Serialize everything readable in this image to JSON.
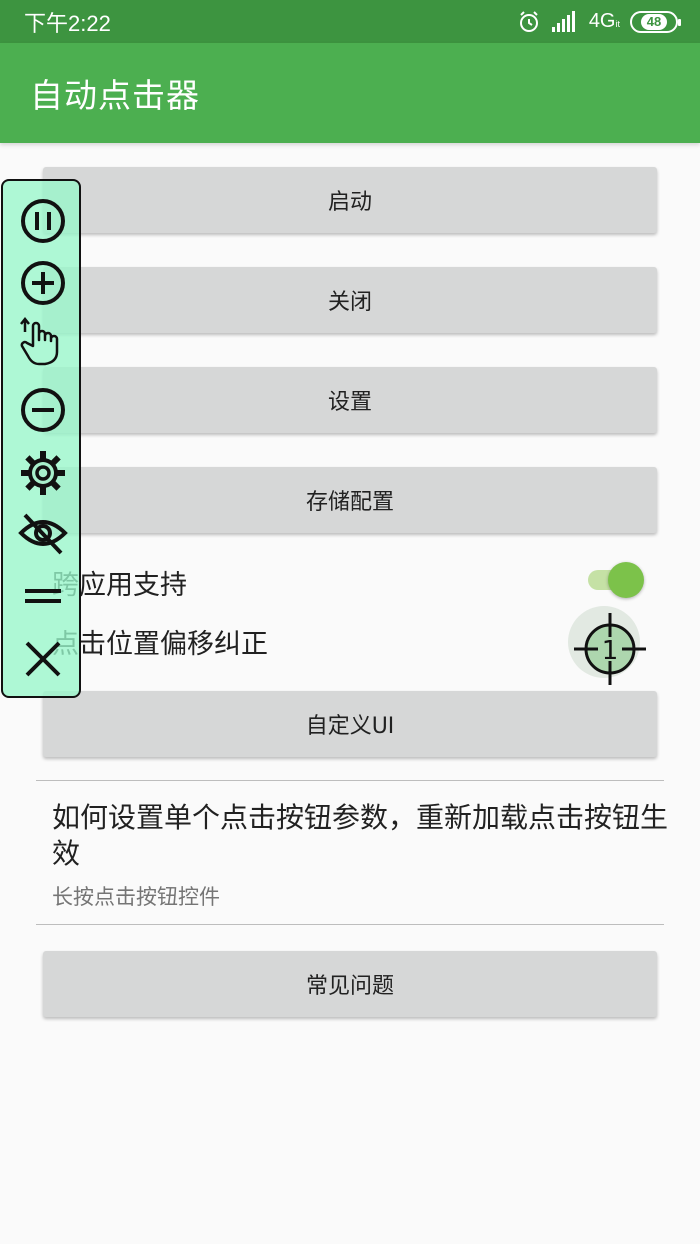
{
  "status_bar": {
    "time": "下午2:22",
    "network": "4G",
    "network_sub": "it",
    "battery": "48",
    "icons": [
      "alarm-icon",
      "signal-icon"
    ]
  },
  "app_bar": {
    "title": "自动点击器"
  },
  "buttons": {
    "start": "启动",
    "close": "关闭",
    "settings": "设置",
    "save_config": "存储配置",
    "custom_ui": "自定义UI",
    "faq": "常见问题"
  },
  "options": {
    "cross_app": {
      "label": "跨应用支持",
      "enabled": true
    },
    "offset": {
      "label": "点击位置偏移纠正",
      "target_number": "1"
    }
  },
  "help": {
    "title": "如何设置单个点击按钮参数，重新加载点击按钮生效",
    "subtitle": "长按点击按钮控件"
  },
  "floating_panel": {
    "icons": [
      "pause-icon",
      "plus-icon",
      "swipe-hand-icon",
      "minus-icon",
      "gear-icon",
      "eye-off-icon",
      "drag-handle-icon",
      "close-icon"
    ]
  },
  "colors": {
    "status_bar": "#3d9440",
    "app_bar": "#4caf50",
    "button": "#d6d7d7",
    "panel": "#99f7cb",
    "toggle_thumb": "#7cc24a"
  }
}
